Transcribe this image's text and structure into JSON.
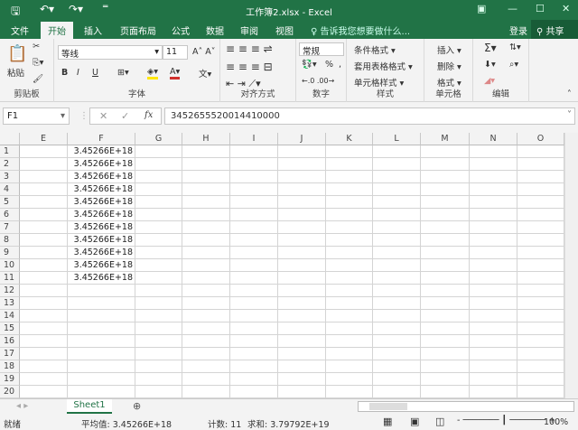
{
  "window": {
    "title": "工作簿2.xlsx - Excel"
  },
  "menu": {
    "tabs": [
      "文件",
      "开始",
      "插入",
      "页面布局",
      "公式",
      "数据",
      "审阅",
      "视图"
    ],
    "tell_me": "告诉我您想要做什么...",
    "login": "登录",
    "share": "共享"
  },
  "ribbon": {
    "clipboard": {
      "label": "剪贴板",
      "paste": "粘贴"
    },
    "font": {
      "label": "字体",
      "name": "等线",
      "size": "11",
      "bold": "B",
      "italic": "I",
      "underline": "U"
    },
    "alignment": {
      "label": "对齐方式"
    },
    "number": {
      "label": "数字",
      "format": "常规",
      "percent": "%",
      "comma": ","
    },
    "styles": {
      "label": "样式",
      "items": [
        "条件格式 ▾",
        "套用表格格式 ▾",
        "单元格样式 ▾"
      ]
    },
    "cells": {
      "label": "单元格",
      "items": [
        "插入 ▾",
        "删除 ▾",
        "格式 ▾"
      ]
    },
    "editing": {
      "label": "编辑"
    }
  },
  "formula_bar": {
    "name_box": "F1",
    "fx": "fx",
    "value": "3452655520014410000"
  },
  "grid": {
    "columns": [
      "E",
      "F",
      "G",
      "H",
      "I",
      "J",
      "K",
      "L",
      "M",
      "N",
      "O"
    ],
    "rows": [
      "1",
      "2",
      "3",
      "4",
      "5",
      "6",
      "7",
      "8",
      "9",
      "10",
      "11",
      "12",
      "13",
      "14",
      "15",
      "16",
      "17",
      "18",
      "19",
      "20"
    ],
    "f_values": [
      "3.45266E+18",
      "3.45266E+18",
      "3.45266E+18",
      "3.45266E+18",
      "3.45266E+18",
      "3.45266E+18",
      "3.45266E+18",
      "3.45266E+18",
      "3.45266E+18",
      "3.45266E+18",
      "3.45266E+18"
    ]
  },
  "sheets": {
    "tabs": [
      "Sheet1"
    ]
  },
  "status": {
    "ready": "就绪",
    "average": "平均值: 3.45266E+18",
    "count": "计数: 11",
    "sum": "求和: 3.79792E+19",
    "zoom": "100%"
  }
}
